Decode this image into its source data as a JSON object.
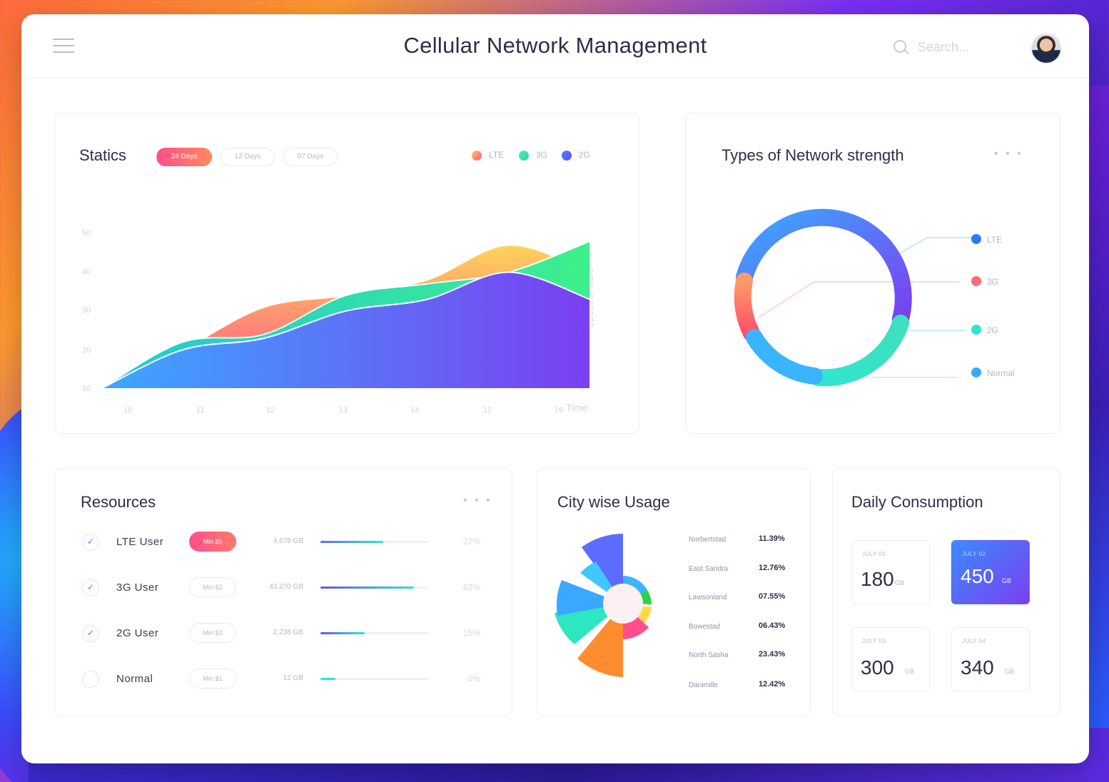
{
  "header": {
    "title": "Cellular Network Management",
    "search_placeholder": "Search..."
  },
  "statics": {
    "title": "Statics",
    "filters": [
      {
        "label": "24 Days",
        "active": true
      },
      {
        "label": "12 Days",
        "active": false
      },
      {
        "label": "07 Days",
        "active": false
      }
    ],
    "legend": [
      {
        "label": "LTE",
        "color": "#ff8a5c"
      },
      {
        "label": "3G",
        "color": "#2ee6b0"
      },
      {
        "label": "2G",
        "color": "#5b6cff"
      }
    ],
    "y_ticks": [
      "50",
      "40",
      "30",
      "20",
      "10"
    ],
    "x_ticks": [
      "10",
      "11",
      "12",
      "13",
      "14",
      "15",
      "16"
    ],
    "y_axis_label": "Speed in mb/s",
    "x_axis_label": "Time"
  },
  "chart_data": {
    "type": "area",
    "x": [
      10,
      11,
      12,
      13,
      14,
      15,
      16
    ],
    "xlabel": "Time",
    "ylabel": "Speed in mb/s",
    "ylim": [
      10,
      50
    ],
    "series": [
      {
        "name": "LTE",
        "values": [
          10,
          20,
          31,
          34,
          38,
          47,
          40
        ]
      },
      {
        "name": "3G",
        "values": [
          10,
          22,
          24,
          34,
          37,
          40,
          48
        ]
      },
      {
        "name": "2G",
        "values": [
          10,
          20,
          23,
          30,
          33,
          40,
          33
        ]
      }
    ]
  },
  "strength": {
    "title": "Types of Network strength",
    "more": "• • •",
    "legend": [
      {
        "label": "LTE",
        "color": "#2b7bff"
      },
      {
        "label": "3G",
        "color": "#ff6b7a"
      },
      {
        "label": "2G",
        "color": "#2ee6d0"
      },
      {
        "label": "Normal",
        "color": "#3ba8ff"
      }
    ]
  },
  "resources": {
    "title": "Resources",
    "more": "• • •",
    "rows": [
      {
        "name": "LTE  User",
        "pill": "Min $5",
        "data": "4,678 GB",
        "pct_label": "27%",
        "fill": 0.58,
        "color": "#5b6cff",
        "checked": true,
        "active": true
      },
      {
        "name": "3G  User",
        "pill": "Min $2",
        "data": "43,270 GB",
        "pct_label": "62%",
        "fill": 0.86,
        "color": "#6a4ff0",
        "checked": true,
        "active": false
      },
      {
        "name": "2G  User",
        "pill": "Min $3",
        "data": "2,238 GB",
        "pct_label": "15%",
        "fill": 0.41,
        "color": "#6a4ff0",
        "checked": true,
        "active": false
      },
      {
        "name": "Normal",
        "pill": "Min $1",
        "data": "12 GB",
        "pct_label": "0%",
        "fill": 0.14,
        "color": "#2ee6d0",
        "checked": false,
        "active": false
      }
    ]
  },
  "city": {
    "title": "City wise Usage",
    "rows": [
      {
        "name": "Norbertstad",
        "value": "11.39%"
      },
      {
        "name": "East Sandra",
        "value": "12.76%"
      },
      {
        "name": "Lawsonland",
        "value": "07.55%"
      },
      {
        "name": "Bowestad",
        "value": "06.43%"
      },
      {
        "name": "North Sasha",
        "value": "23.43%"
      },
      {
        "name": "Danimille",
        "value": "12.42%"
      }
    ]
  },
  "daily": {
    "title": "Daily Consumption",
    "unit": "GB",
    "days": [
      {
        "label": "JULY 01",
        "value": "180",
        "active": false
      },
      {
        "label": "JULY 02",
        "value": "450",
        "active": true
      },
      {
        "label": "JULY 03",
        "value": "300",
        "active": false
      },
      {
        "label": "JULY 04",
        "value": "340",
        "active": false
      }
    ]
  }
}
